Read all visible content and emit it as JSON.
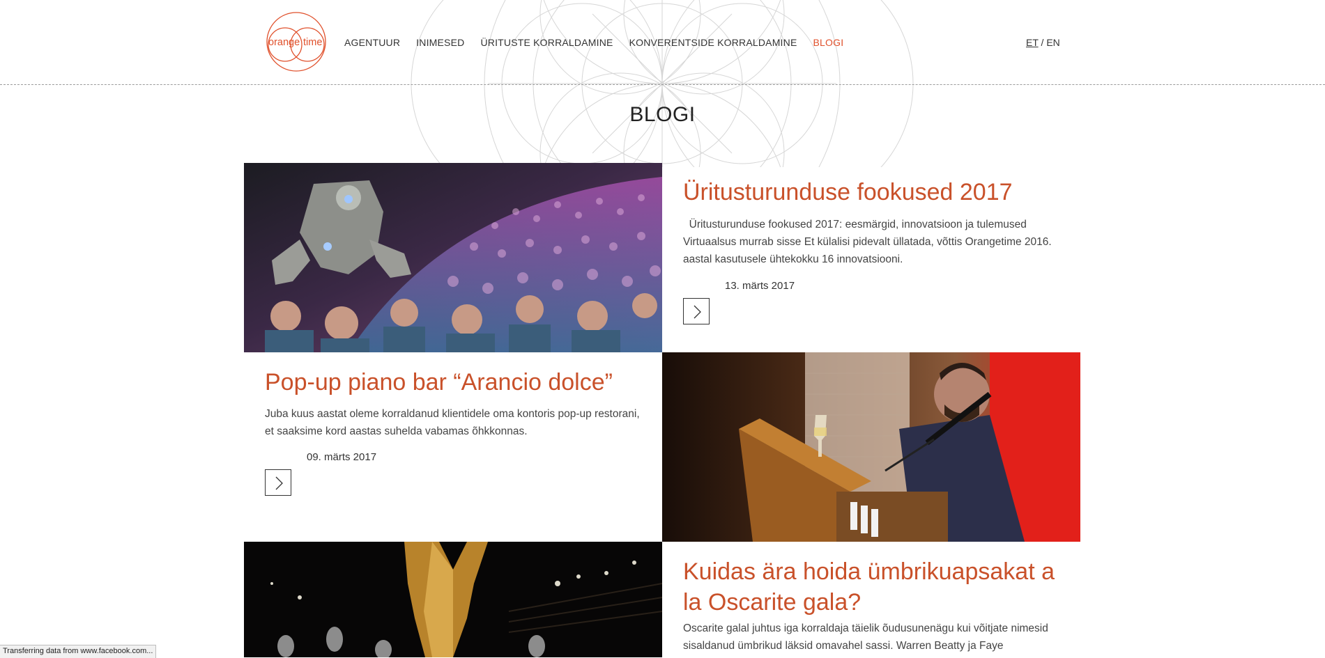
{
  "logo": {
    "left_text": "orange",
    "right_text": "time",
    "color": "#e0502b"
  },
  "nav": {
    "items": [
      {
        "label": "AGENTUUR",
        "active": false
      },
      {
        "label": "INIMESED",
        "active": false
      },
      {
        "label": "ÜRITUSTE KORRALDAMINE",
        "active": false
      },
      {
        "label": "KONVERENTSIDE KORRALDAMINE",
        "active": false
      },
      {
        "label": "BLOGI",
        "active": true
      }
    ]
  },
  "lang": {
    "et": "ET",
    "separator": " / ",
    "en": "EN"
  },
  "page": {
    "title": "BLOGI"
  },
  "posts": [
    {
      "title": "Üritusturunduse fookused 2017",
      "excerpt": "  Üritusturunduse fookused 2017: eesmärgid, innovatsioon ja tulemused Virtuaalsus murrab sisse Et külalisi pidevalt üllatada, võttis Orangetime 2016. aastal kasutusele ühtekokku 16 innovatsiooni.",
      "date": "13. märts 2017",
      "image": "robot-audience-photo"
    },
    {
      "title": "Pop-up piano bar “Arancio dolce”",
      "excerpt": "Juba kuus aastat oleme korraldanud klientidele oma kontoris pop-up restorani, et saaksime kord aastas suhelda vabamas õhkkonnas.",
      "date": "09. märts 2017",
      "image": "piano-singer-photo"
    },
    {
      "title": "Kuidas ära hoida ümbrikuapsakat a la Oscarite gala?",
      "excerpt": "Oscarite galal juhtus iga korraldaja täielik õudusunenägu kui võitjate nimesid sisaldanud ümbrikud läksid omavahel sassi. Warren Beatty ja Faye",
      "image": "oscar-statue-photo"
    }
  ],
  "status": {
    "text": "Transferring data from www.facebook.com..."
  },
  "colors": {
    "accent": "#e0502b",
    "title": "#c9512a"
  },
  "icons": {
    "next": "chevron-right-icon"
  }
}
